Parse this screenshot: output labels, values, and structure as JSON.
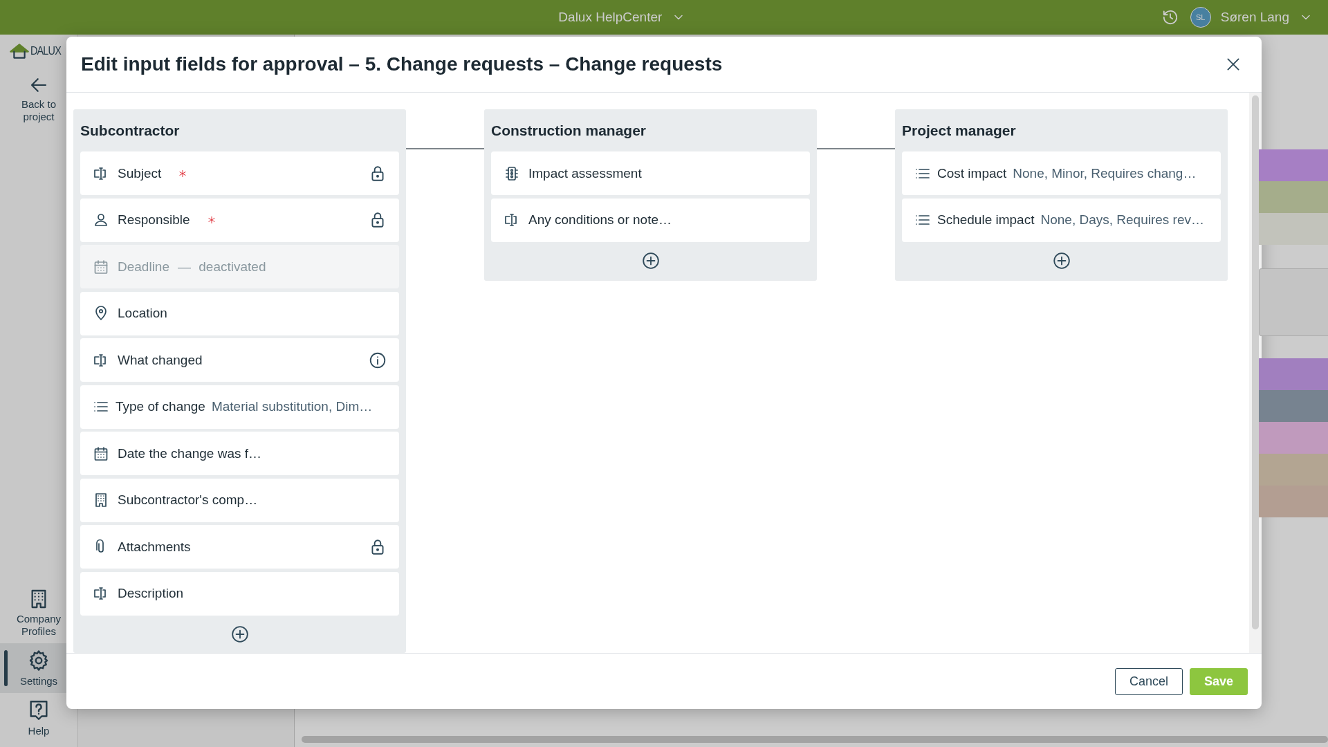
{
  "topbar": {
    "title": "Dalux HelpCenter",
    "user": {
      "initials": "SL",
      "name": "Søren Lang"
    }
  },
  "sidebar": {
    "logo": "DALUX",
    "back": "Back to project",
    "items": [
      {
        "label": "Company Profiles",
        "kind": "building",
        "selected": false
      },
      {
        "label": "Settings",
        "kind": "gear",
        "selected": true
      },
      {
        "label": "Help",
        "kind": "help",
        "selected": false
      }
    ]
  },
  "background": {
    "bands": [
      {
        "color": "#a67fc4"
      },
      {
        "color": "#a5ad8b"
      },
      {
        "color": "#c2c3bb"
      },
      {
        "kind": "gap"
      },
      {
        "color": "#a17fbf"
      },
      {
        "color": "#778390"
      },
      {
        "color": "#c09abd"
      },
      {
        "color": "#b3a592"
      },
      {
        "color": "#b39e92"
      }
    ]
  },
  "dialog": {
    "title": "Edit input fields for approval – 5. Change requests – Change requests",
    "columns": [
      {
        "title": "Subcontractor",
        "fields": [
          {
            "kind": "text",
            "label": "Subject",
            "required": true,
            "locked": true,
            "info": false,
            "disabled": false
          },
          {
            "kind": "person",
            "label": "Responsible",
            "required": true,
            "locked": true,
            "info": false,
            "disabled": false
          },
          {
            "kind": "calendar",
            "label": "Deadline",
            "note": "— deactivated",
            "required": false,
            "locked": false,
            "info": false,
            "disabled": true
          },
          {
            "kind": "location",
            "label": "Location",
            "required": false,
            "locked": false,
            "info": false,
            "disabled": false
          },
          {
            "kind": "text",
            "label": "What changed",
            "required": false,
            "locked": false,
            "info": true,
            "disabled": false
          },
          {
            "kind": "list",
            "label": "Type of change",
            "value": "Material substitution, Dim…",
            "required": false,
            "locked": false,
            "info": false,
            "disabled": false
          },
          {
            "kind": "calendar",
            "label": "Date the change was f…",
            "required": false,
            "locked": false,
            "info": false,
            "disabled": false
          },
          {
            "kind": "building",
            "label": "Subcontractor's comp…",
            "required": false,
            "locked": false,
            "info": false,
            "disabled": false
          },
          {
            "kind": "attachment",
            "label": "Attachments",
            "required": false,
            "locked": true,
            "info": false,
            "disabled": false
          },
          {
            "kind": "text",
            "label": "Description",
            "required": false,
            "locked": false,
            "info": false,
            "disabled": false
          }
        ]
      },
      {
        "title": "Construction manager",
        "fields": [
          {
            "kind": "traffic",
            "label": "Impact assessment",
            "required": false,
            "locked": false,
            "info": false,
            "disabled": false
          },
          {
            "kind": "text",
            "label": "Any conditions or note…",
            "required": false,
            "locked": false,
            "info": false,
            "disabled": false
          }
        ]
      },
      {
        "title": "Project manager",
        "fields": [
          {
            "kind": "list",
            "label": "Cost impact",
            "value": "None, Minor, Requires chang…",
            "required": false,
            "locked": false,
            "info": false,
            "disabled": false
          },
          {
            "kind": "list",
            "label": "Schedule impact",
            "value": "None, Days, Requires rev…",
            "required": false,
            "locked": false,
            "info": false,
            "disabled": false
          }
        ]
      }
    ],
    "buttons": [
      {
        "label": "Cancel",
        "kind": "secondary"
      },
      {
        "label": "Save",
        "kind": "primary"
      }
    ]
  }
}
